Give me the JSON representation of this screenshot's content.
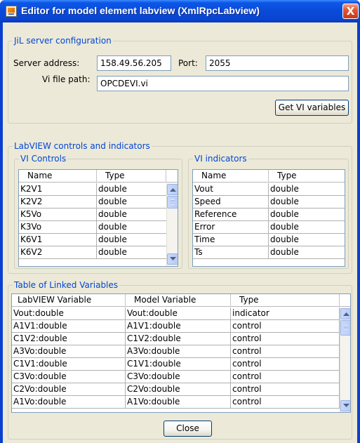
{
  "window": {
    "title": "Editor for model element labview (XmlRpcLabview)",
    "close_glyph": "X"
  },
  "server_config": {
    "group_label": "JiL server configuration",
    "address_label": "Server address:",
    "address_value": "158.49.56.205",
    "port_label": "Port:",
    "port_value": "2055",
    "vi_path_label": "Vi file path:",
    "vi_path_value": "OPCDEVI.vi",
    "get_vars_label": "Get VI variables"
  },
  "labview": {
    "group_label": "LabVIEW controls and indicators",
    "controls": {
      "group_label": "VI Controls",
      "columns": [
        "Name",
        "Type"
      ],
      "rows": [
        [
          "K2V1",
          "double"
        ],
        [
          "K2V2",
          "double"
        ],
        [
          "K5Vo",
          "double"
        ],
        [
          "K3Vo",
          "double"
        ],
        [
          "K6V1",
          "double"
        ],
        [
          "K6V2",
          "double"
        ]
      ]
    },
    "indicators": {
      "group_label": "VI indicators",
      "columns": [
        "Name",
        "Type"
      ],
      "rows": [
        [
          "Vout",
          "double"
        ],
        [
          "Speed",
          "double"
        ],
        [
          "Reference",
          "double"
        ],
        [
          "Error",
          "double"
        ],
        [
          "Time",
          "double"
        ],
        [
          "Ts",
          "double"
        ]
      ]
    }
  },
  "linked": {
    "group_label": "Table of Linked Variables",
    "columns": [
      "LabVIEW Variable",
      "Model Variable",
      "Type"
    ],
    "rows": [
      [
        "Vout:double",
        "Vout:double",
        "indicator"
      ],
      [
        "A1V1:double",
        "A1V1:double",
        "control"
      ],
      [
        "C1V2:double",
        "C1V2:double",
        "control"
      ],
      [
        "A3Vo:double",
        "A3Vo:double",
        "control"
      ],
      [
        "C1V1:double",
        "C1V1:double",
        "control"
      ],
      [
        "C3Vo:double",
        "C3Vo:double",
        "control"
      ],
      [
        "C2Vo:double",
        "C2Vo:double",
        "control"
      ],
      [
        "A1Vo:double",
        "A1Vo:double",
        "control"
      ]
    ]
  },
  "footer": {
    "close_label": "Close"
  },
  "colors": {
    "title_bar": "#0a4ad8",
    "group_label": "#0046d5",
    "dialog_bg": "#ece9d8",
    "close_button": "#e25530"
  },
  "icons": {
    "app": "java-cup-icon",
    "close": "close-icon",
    "scroll_up": "scroll-up-icon",
    "scroll_down": "scroll-down-icon"
  }
}
